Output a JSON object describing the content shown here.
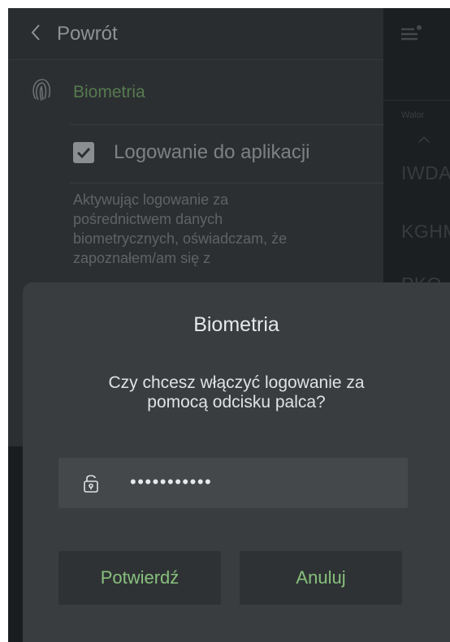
{
  "header": {
    "back_label": "Powrót"
  },
  "settings": {
    "section_title": "Biometria",
    "checkbox_label": "Logowanie do aplikacji",
    "checkbox_checked": true,
    "description_lines": [
      "Aktywując logowanie za",
      "pośrednictwem danych",
      "biometrycznych, oświadczam, że",
      "zapoznałem/am się z"
    ]
  },
  "side_panel": {
    "header": "Walor",
    "tickers": [
      "IWDA",
      "KGHM",
      "PKO"
    ]
  },
  "dialog": {
    "title": "Biometria",
    "message_lines": [
      "Czy chcesz włączyć logowanie za",
      "pomocą odcisku palca?"
    ],
    "password_value": "•••••••••••",
    "confirm_label": "Potwierdź",
    "cancel_label": "Anuluj"
  },
  "colors": {
    "accent_green": "#87c07c",
    "dimmed_green": "#567a4f",
    "dialog_bg": "#393d40",
    "field_bg": "#44484b",
    "button_bg": "#2f3235"
  },
  "icons": [
    "chevron-left-icon",
    "fingerprint-icon",
    "checkmark-icon",
    "menu-notification-icon",
    "caret-up-icon",
    "unlock-icon"
  ]
}
